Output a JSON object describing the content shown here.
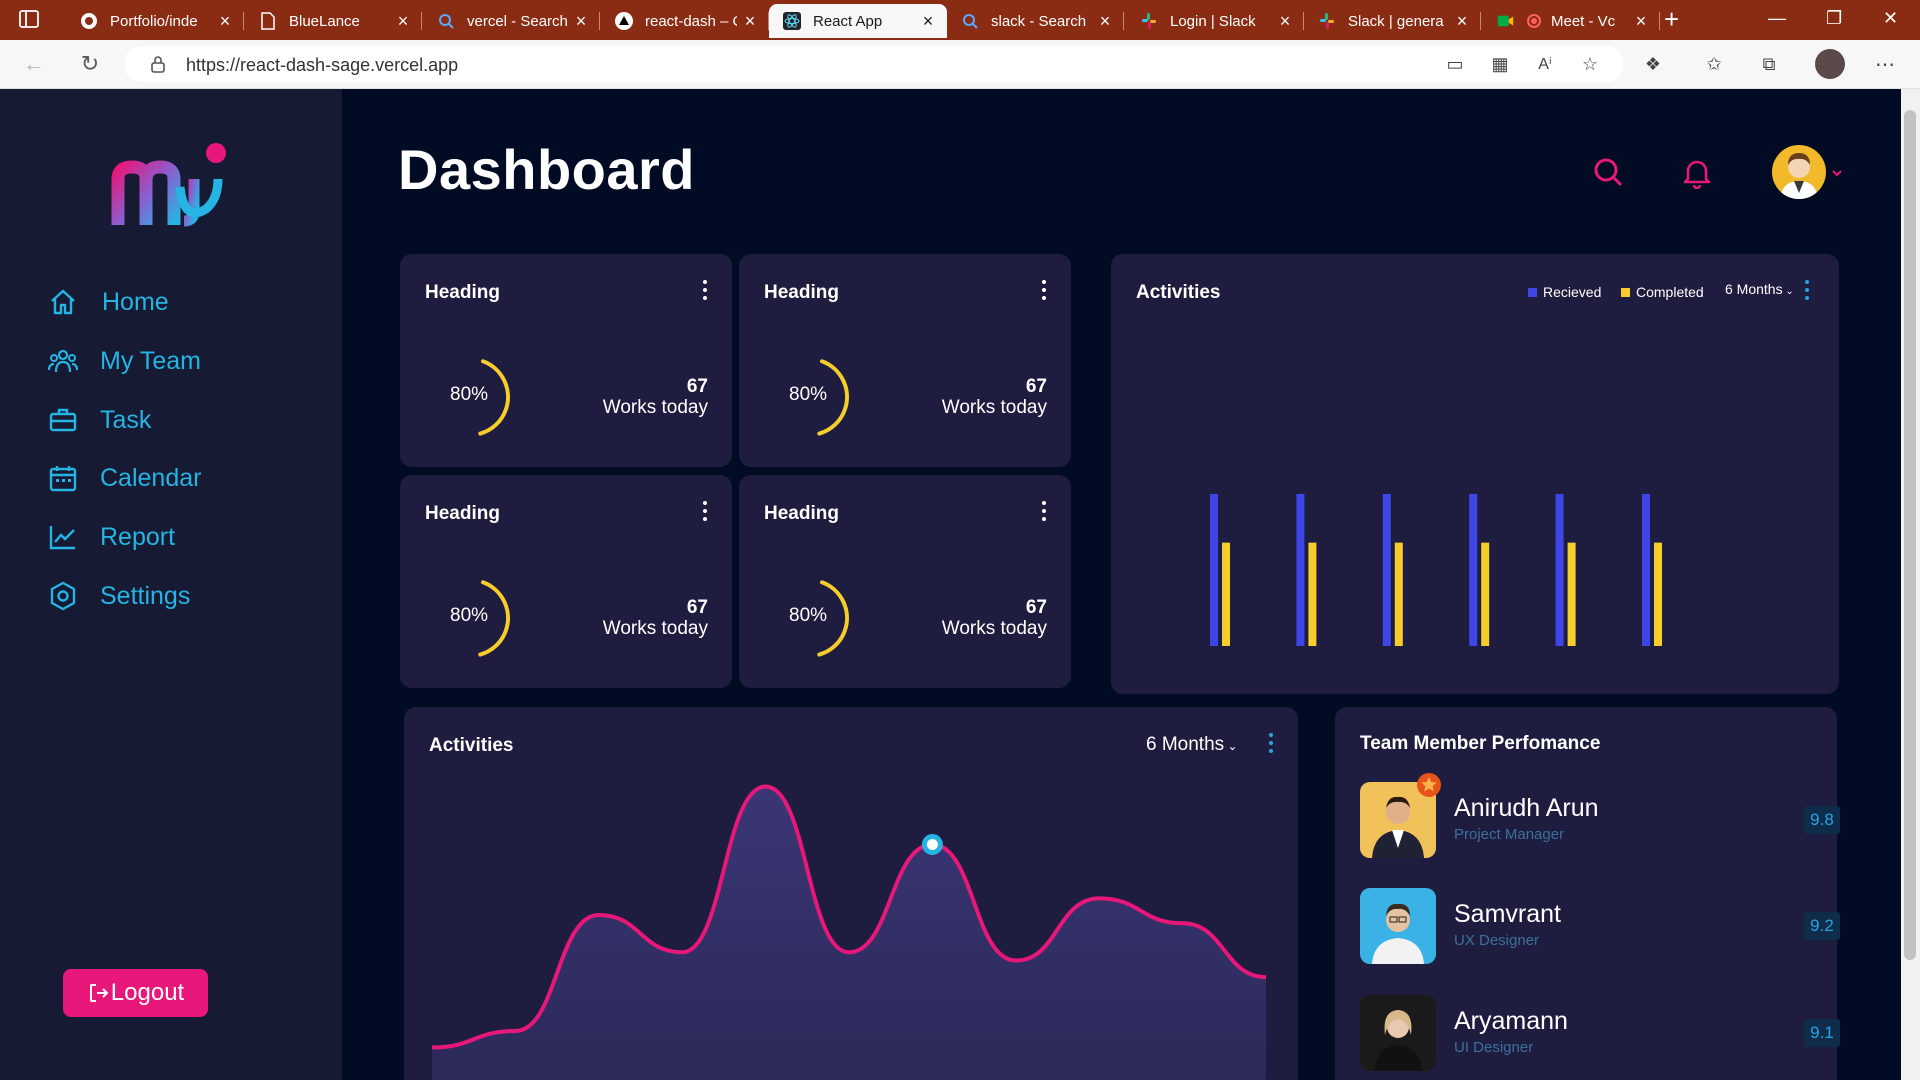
{
  "browser": {
    "tabs": [
      {
        "title": "Portfolio/inde",
        "icon": "github-icon"
      },
      {
        "title": "BlueLance",
        "icon": "document-icon"
      },
      {
        "title": "vercel - Search",
        "icon": "search-icon"
      },
      {
        "title": "react-dash – C",
        "icon": "vercel-icon"
      },
      {
        "title": "React App",
        "icon": "react-icon"
      },
      {
        "title": "slack - Search",
        "icon": "search-icon"
      },
      {
        "title": "Login | Slack",
        "icon": "slack-icon"
      },
      {
        "title": "Slack | genera",
        "icon": "slack-icon"
      },
      {
        "title": "Meet - Vc",
        "icon": "meet-icon"
      }
    ],
    "url": "https://react-dash-sage.vercel.app"
  },
  "sidebar": {
    "items": [
      {
        "label": "Home",
        "icon": "home-icon"
      },
      {
        "label": "My Team",
        "icon": "team-icon"
      },
      {
        "label": "Task",
        "icon": "briefcase-icon"
      },
      {
        "label": "Calendar",
        "icon": "calendar-icon"
      },
      {
        "label": "Report",
        "icon": "chart-line-icon"
      },
      {
        "label": "Settings",
        "icon": "settings-icon"
      }
    ],
    "logout_label": "Logout"
  },
  "header": {
    "title": "Dashboard"
  },
  "stat_cards": [
    {
      "heading": "Heading",
      "percent": "80%",
      "count": "67",
      "caption": "Works today",
      "progress": 0.8
    },
    {
      "heading": "Heading",
      "percent": "80%",
      "count": "67",
      "caption": "Works today",
      "progress": 0.8
    },
    {
      "heading": "Heading",
      "percent": "80%",
      "count": "67",
      "caption": "Works today",
      "progress": 0.8
    },
    {
      "heading": "Heading",
      "percent": "80%",
      "count": "67",
      "caption": "Works today",
      "progress": 0.8
    }
  ],
  "activities_bar": {
    "title": "Activities",
    "legend": [
      "Recieved",
      "Completed"
    ],
    "period": "6 Months"
  },
  "activities_line": {
    "title": "Activities",
    "period": "6 Months"
  },
  "team": {
    "title": "Team Member Perfomance",
    "members": [
      {
        "name": "Anirudh Arun",
        "role": "Project Manager",
        "score": "9.8"
      },
      {
        "name": "Samvrant",
        "role": "UX Designer",
        "score": "9.2"
      },
      {
        "name": "Aryamann",
        "role": "UI Designer",
        "score": "9.1"
      }
    ]
  },
  "colors": {
    "accent_pink": "#e8177a",
    "accent_blue": "#25b4e3",
    "received_bar": "#3e46e8",
    "completed_bar": "#f7cd2b",
    "card_bg": "#1e1d3f",
    "page_bg": "#020b24"
  },
  "chart_data": [
    {
      "type": "bar",
      "title": "Activities",
      "categories": [
        "",
        "",
        "",
        "",
        "",
        ""
      ],
      "series": [
        {
          "name": "Recieved",
          "values": [
            100,
            100,
            100,
            100,
            100,
            100
          ]
        },
        {
          "name": "Completed",
          "values": [
            68,
            68,
            68,
            68,
            68,
            68
          ]
        }
      ],
      "legend": "top-right",
      "grid": false
    },
    {
      "type": "area",
      "title": "Activities",
      "x": [
        0,
        1,
        2,
        3,
        4,
        5,
        6,
        7,
        8,
        9,
        10
      ],
      "y": [
        10,
        14,
        42,
        33,
        73,
        33,
        59,
        31,
        46,
        40,
        27
      ],
      "highlight_index": 6,
      "grid": false
    }
  ]
}
